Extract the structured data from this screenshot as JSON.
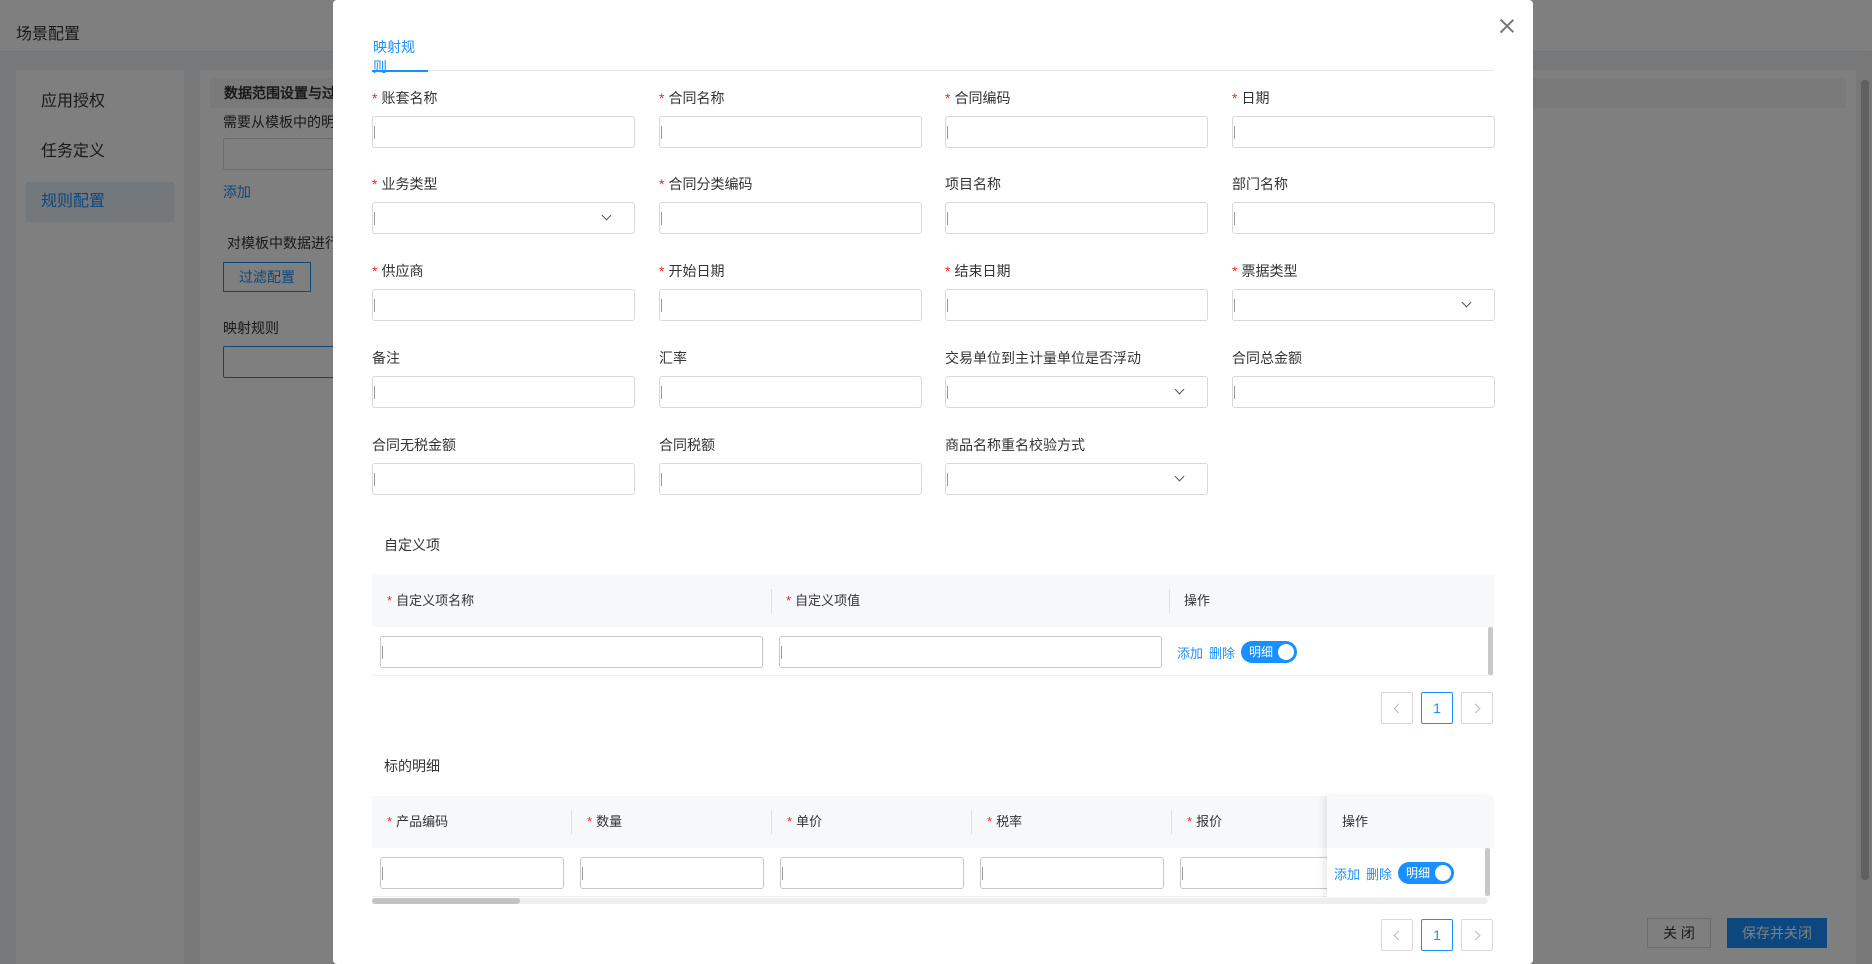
{
  "background": {
    "title": "场景配置",
    "sidebar": [
      {
        "label": "应用授权"
      },
      {
        "label": "任务定义"
      },
      {
        "label": "规则配置"
      }
    ],
    "section_title": "数据范围设置与过",
    "desc1": "需要从模板中的明",
    "add_link": "添加",
    "desc2": "对模板中数据进行",
    "filter_button": "过滤配置",
    "mapping_label": "映射规则",
    "close_button": "关 闭",
    "save_close_button": "保存并关闭"
  },
  "modal": {
    "tab": "映射规则",
    "fields": [
      {
        "label": "账套名称",
        "required": true,
        "type": "input"
      },
      {
        "label": "合同名称",
        "required": true,
        "type": "input"
      },
      {
        "label": "合同编码",
        "required": true,
        "type": "input"
      },
      {
        "label": "日期",
        "required": true,
        "type": "input"
      },
      {
        "label": "业务类型",
        "required": true,
        "type": "select"
      },
      {
        "label": "合同分类编码",
        "required": true,
        "type": "input"
      },
      {
        "label": "项目名称",
        "required": false,
        "type": "input"
      },
      {
        "label": "部门名称",
        "required": false,
        "type": "input"
      },
      {
        "label": "供应商",
        "required": true,
        "type": "input"
      },
      {
        "label": "开始日期",
        "required": true,
        "type": "input"
      },
      {
        "label": "结束日期",
        "required": true,
        "type": "input"
      },
      {
        "label": "票据类型",
        "required": true,
        "type": "select"
      },
      {
        "label": "备注",
        "required": false,
        "type": "input"
      },
      {
        "label": "汇率",
        "required": false,
        "type": "input"
      },
      {
        "label": "交易单位到主计量单位是否浮动",
        "required": false,
        "type": "select"
      },
      {
        "label": "合同总金额",
        "required": false,
        "type": "input"
      },
      {
        "label": "合同无税金额",
        "required": false,
        "type": "input"
      },
      {
        "label": "合同税额",
        "required": false,
        "type": "input"
      },
      {
        "label": "商品名称重名校验方式",
        "required": false,
        "type": "select"
      }
    ],
    "custom_section": {
      "title": "自定义项",
      "columns": [
        "自定义项名称",
        "自定义项值",
        "操作"
      ],
      "row": {
        "add": "添加",
        "delete": "删除",
        "toggle": "明细"
      },
      "page": "1"
    },
    "detail_section": {
      "title": "标的明细",
      "columns": [
        "产品编码",
        "数量",
        "单价",
        "税率",
        "报价",
        "操作"
      ],
      "row": {
        "add": "添加",
        "delete": "删除",
        "toggle": "明细"
      },
      "page": "1"
    }
  }
}
